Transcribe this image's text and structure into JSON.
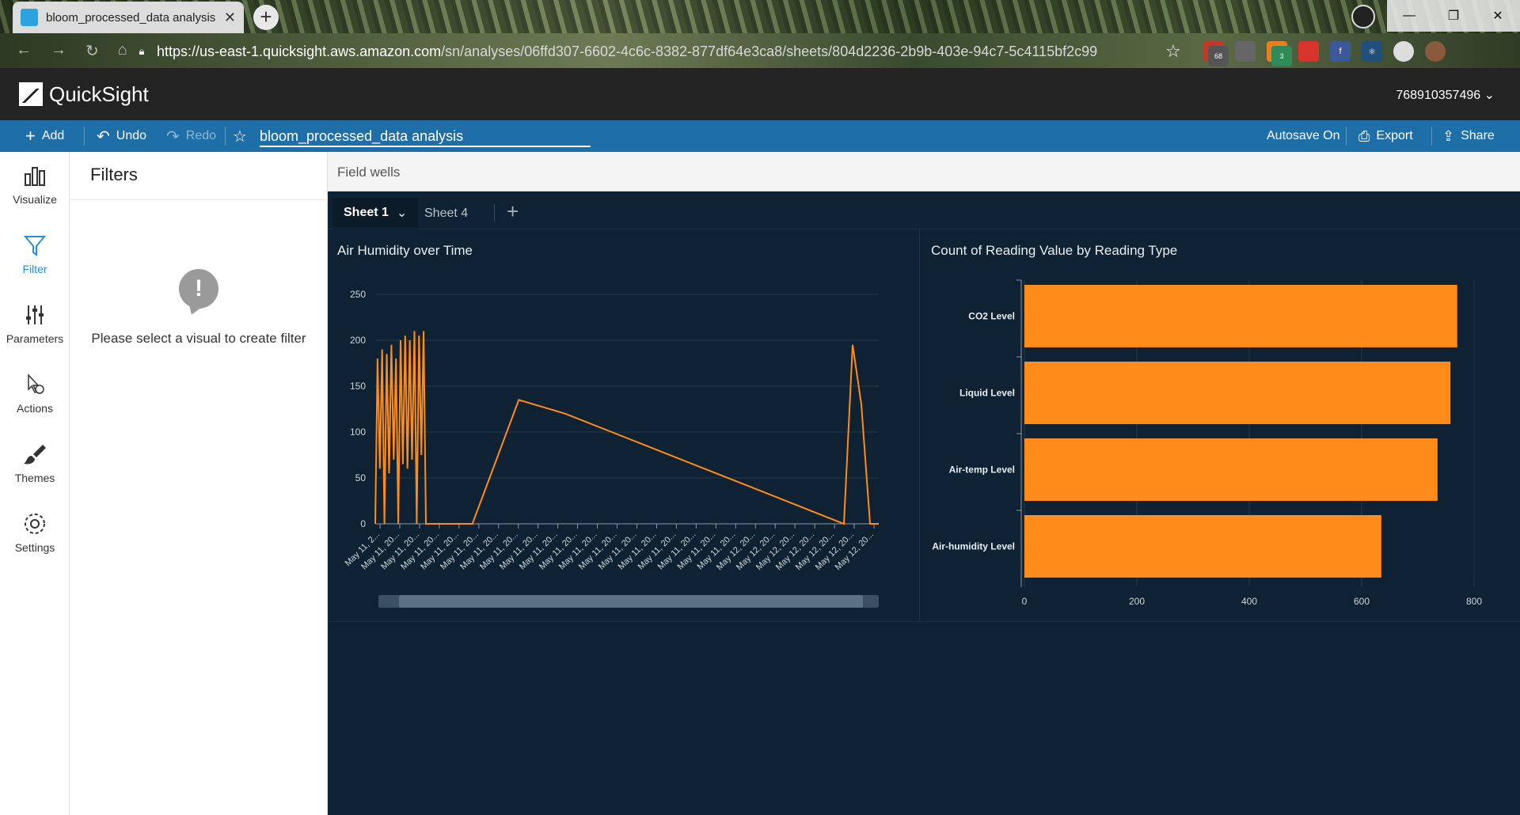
{
  "browser": {
    "tab_title": "bloom_processed_data analysis",
    "url_host": "https://us-east-1.quicksight.aws.amazon.com",
    "url_path": "/sn/analyses/06ffd307-6602-4c6c-8382-877df64e3ca8/sheets/804d2236-2b9b-403e-94c7-5c4115bf2c99",
    "ext_badges": [
      "68",
      "3"
    ]
  },
  "header": {
    "brand": "QuickSight",
    "account": "768910357496"
  },
  "toolbar": {
    "add_label": "Add",
    "undo_label": "Undo",
    "redo_label": "Redo",
    "analysis_name": "bloom_processed_data analysis",
    "autosave_label": "Autosave On",
    "export_label": "Export",
    "share_label": "Share"
  },
  "rail": {
    "items": [
      {
        "label": "Visualize",
        "icon": "bar-chart-icon"
      },
      {
        "label": "Filter",
        "icon": "funnel-icon"
      },
      {
        "label": "Parameters",
        "icon": "sliders-icon"
      },
      {
        "label": "Actions",
        "icon": "pointer-gear-icon"
      },
      {
        "label": "Themes",
        "icon": "paintbrush-icon"
      },
      {
        "label": "Settings",
        "icon": "gear-icon"
      }
    ]
  },
  "filters": {
    "title": "Filters",
    "message": "Please select a visual to create filter"
  },
  "field_wells": {
    "label": "Field wells"
  },
  "sheets": {
    "tabs": [
      "Sheet 1",
      "Sheet 4"
    ]
  },
  "colors": {
    "accent": "#ff8c1a",
    "canvas": "#0e2233",
    "toolbar": "#1e6ea7"
  },
  "chart_data": [
    {
      "type": "line",
      "title": "Air Humidity over Time",
      "ylim": [
        0,
        250
      ],
      "y_ticks": [
        0,
        50,
        100,
        150,
        200,
        250
      ],
      "x_tick_labels": [
        "May 11, 2...",
        "May 11, 20...",
        "May 11, 20...",
        "May 11, 20...",
        "May 11, 20...",
        "May 11, 20...",
        "May 11, 20...",
        "May 11, 20...",
        "May 11, 20...",
        "May 11, 20...",
        "May 11, 20...",
        "May 11, 20...",
        "May 11, 20...",
        "May 11, 20...",
        "May 11, 20...",
        "May 11, 20...",
        "May 11, 20...",
        "May 11, 20...",
        "May 11, 20...",
        "May 12, 20...",
        "May 12, 20...",
        "May 12, 20...",
        "May 12, 20...",
        "May 12, 20...",
        "May 12, 20...",
        "May 12, 20..."
      ],
      "series": [
        {
          "values": [
            0,
            180,
            60,
            190,
            0,
            185,
            55,
            195,
            70,
            180,
            0,
            200,
            65,
            205,
            60,
            200,
            70,
            210,
            0,
            205,
            75,
            210,
            0,
            0,
            135,
            120,
            100,
            80,
            60,
            40,
            20,
            0,
            195,
            130,
            0,
            0
          ]
        }
      ]
    },
    {
      "type": "bar",
      "orientation": "horizontal",
      "title": "Count of Reading Value by Reading Type",
      "categories": [
        "CO2 Level",
        "Liquid Level",
        "Air-temp Level",
        "Air-humidity Level"
      ],
      "values": [
        770,
        758,
        735,
        635
      ],
      "xlim": [
        0,
        800
      ],
      "x_ticks": [
        0,
        200,
        400,
        600,
        800
      ]
    }
  ]
}
